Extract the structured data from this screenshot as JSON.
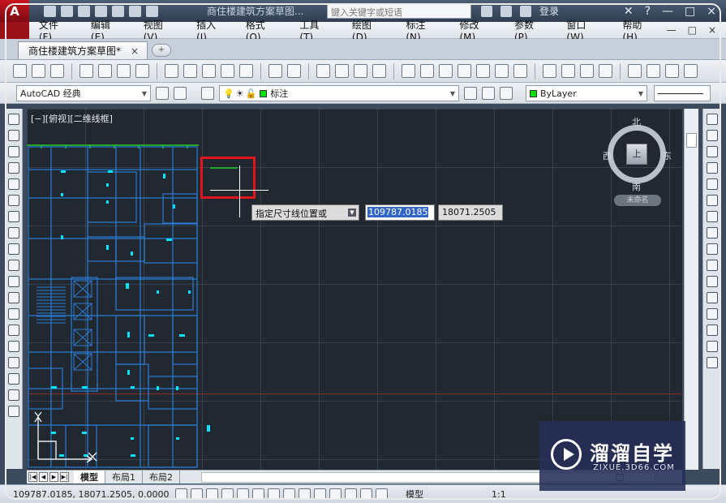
{
  "titlebar": {
    "app_logo": "A",
    "title": "商住楼建筑方案草图...",
    "search_placeholder": "键入关键字或短语",
    "login": "登录",
    "close_glyph": "×",
    "minimize_glyph": "—",
    "maximize_glyph": "□"
  },
  "menu": {
    "items": [
      "文件(F)",
      "编辑(E)",
      "视图(V)",
      "插入(I)",
      "格式(O)",
      "工具(T)",
      "绘图(D)",
      "标注(N)",
      "修改(M)",
      "参数(P)",
      "窗口(W)",
      "帮助(H)"
    ],
    "win_minimize": "—",
    "win_restore": "□",
    "win_close": "×"
  },
  "tabs": {
    "doc_tab": "商住楼建筑方案草图*",
    "doc_close": "×",
    "new_tab": "+"
  },
  "toolbar2": {
    "workspace": "AutoCAD 经典",
    "layer": "标注",
    "color": "ByLayer"
  },
  "canvas": {
    "viewport_label": "[−][俯视][二维线框]",
    "prompt": "指定尺寸线位置或",
    "x_value": "109787.0185",
    "y_value": "18071.2505"
  },
  "viewcube": {
    "north": "北",
    "south": "南",
    "west": "西",
    "east": "东",
    "face": "上",
    "ucs": "未命名"
  },
  "layout_tabs": {
    "model": "模型",
    "layout1": "布局1",
    "layout2": "布局2"
  },
  "statusbar": {
    "coords": "109787.0185, 18071.2505, 0.0000",
    "model": "模型",
    "scale": "1:1"
  },
  "watermark": {
    "title": "溜溜自学",
    "subtitle": "ZIXUE.3D66.COM"
  },
  "colors": {
    "canvas_bg": "#212830",
    "plan_lines": "#2a7bd4",
    "plan_green": "#22c92a",
    "plan_cyan": "#00e5ff",
    "selection_red": "#e0161c",
    "watermark_bg": "#262e58"
  }
}
